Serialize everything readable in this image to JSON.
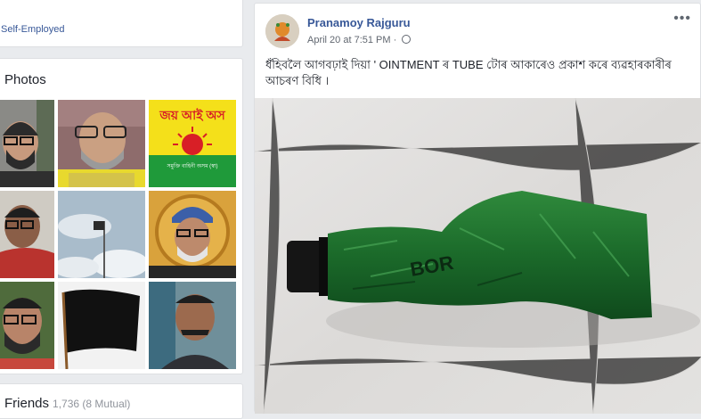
{
  "intro": {
    "work_text": "Self-Employed"
  },
  "photos": {
    "title": "Photos",
    "thumbnails": [
      {
        "icon": "person-photo",
        "bg": "#7b7b7b"
      },
      {
        "icon": "person-photo",
        "bg": "#b59a6a"
      },
      {
        "icon": "flag-banner",
        "bg": "#f4e01a",
        "text": "জয় আই অস",
        "subtext": "সমুক্তি বাহিনী অসম (স্বা)"
      },
      {
        "icon": "person-photo",
        "bg": "#c7c2b8"
      },
      {
        "icon": "flag-sky-photo",
        "bg": "#9fb2c0"
      },
      {
        "icon": "person-photo",
        "bg": "#d9a23c"
      },
      {
        "icon": "person-photo",
        "bg": "#4f6b3c"
      },
      {
        "icon": "black-flag",
        "bg": "#f2f2f2"
      },
      {
        "icon": "person-photo",
        "bg": "#5c7f95"
      }
    ]
  },
  "friends": {
    "title": "Friends",
    "count": "1,736 (8 Mutual)"
  },
  "post": {
    "author": "Pranamoy Rajguru",
    "timestamp": "April 20 at 7:51 PM",
    "text": "ধঁহিবলৈ আগবঢ়াই দিয়া ' OINTMENT ৰ TUBE টোৰ আকাৰেও প্ৰকাশ কৰে ব্যৱহাৰকাৰীৰ আচৰণ বিধি ।",
    "image_text": "BOR",
    "more_label": "•••"
  },
  "colors": {
    "link": "#385898",
    "page_bg": "#e9ebee",
    "tube": "#1f6b2c"
  }
}
